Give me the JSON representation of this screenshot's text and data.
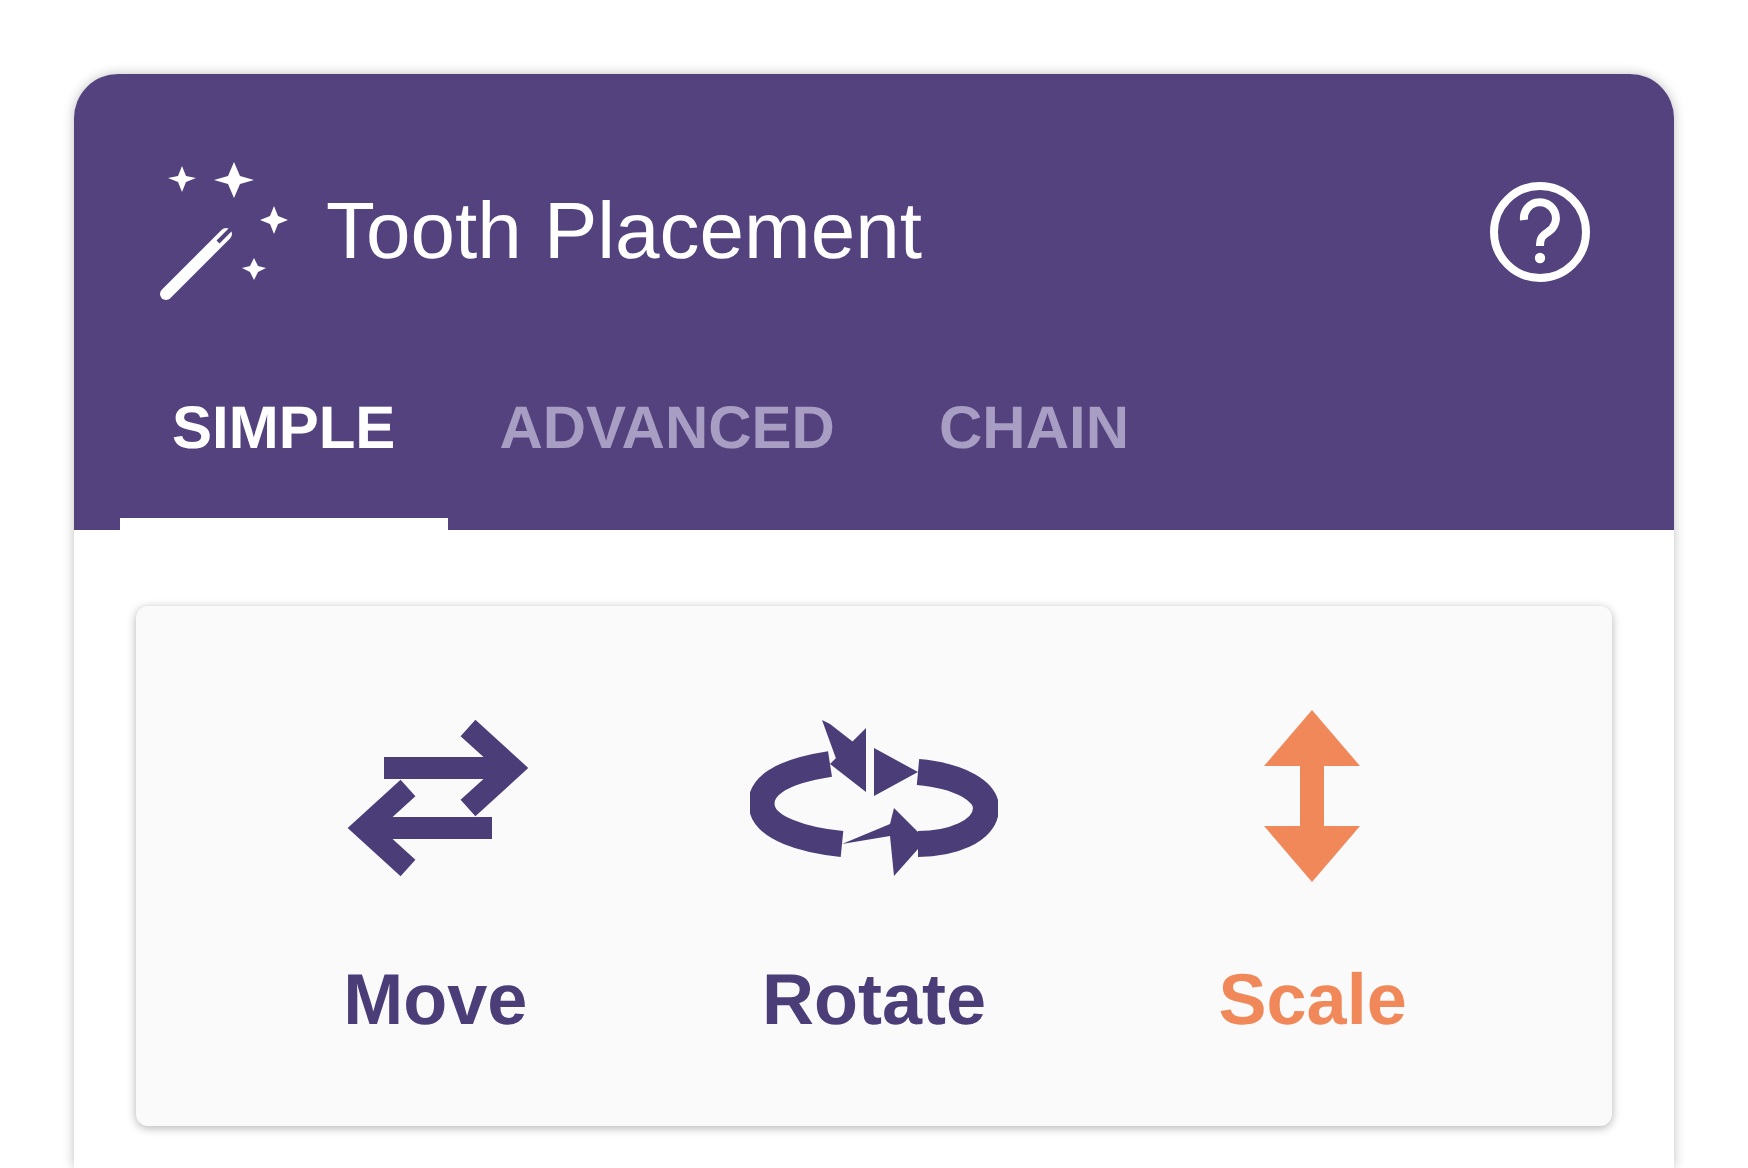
{
  "panel": {
    "title": "Tooth Placement"
  },
  "tabs": [
    {
      "label": "SIMPLE",
      "selected": true
    },
    {
      "label": "ADVANCED",
      "selected": false
    },
    {
      "label": "CHAIN",
      "selected": false
    }
  ],
  "tools": [
    {
      "kind": "move",
      "label": "Move",
      "selected": false
    },
    {
      "kind": "rotate",
      "label": "Rotate",
      "selected": false
    },
    {
      "kind": "scale",
      "label": "Scale",
      "selected": true
    }
  ]
}
